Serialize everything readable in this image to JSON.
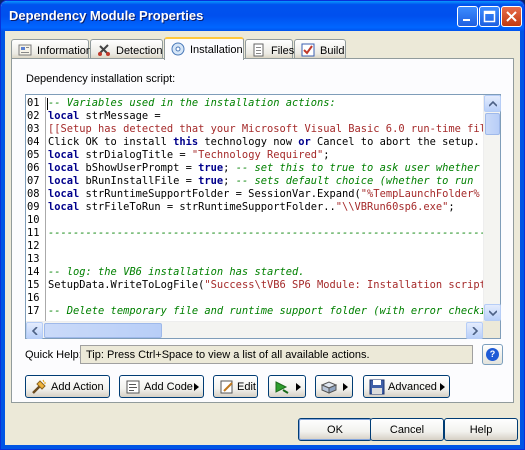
{
  "window": {
    "title": "Dependency Module Properties"
  },
  "tabs": [
    {
      "label": "Information",
      "icon": "information-icon"
    },
    {
      "label": "Detection",
      "icon": "detection-icon"
    },
    {
      "label": "Installation",
      "icon": "installation-icon",
      "active": true
    },
    {
      "label": "Files",
      "icon": "files-icon"
    },
    {
      "label": "Build",
      "icon": "build-icon"
    }
  ],
  "panel": {
    "script_label": "Dependency installation script:"
  },
  "editor": {
    "lines": [
      {
        "num": "01",
        "segments": [
          {
            "t": "-- Variables used in the installation actions:",
            "c": "comment"
          }
        ]
      },
      {
        "num": "02",
        "segments": [
          {
            "t": "local",
            "c": "kw"
          },
          {
            "t": " strMessage =",
            "c": "text"
          }
        ]
      },
      {
        "num": "03",
        "segments": [
          {
            "t": "[[Setup has detected that your Microsoft Visual Basic 6.0 run-time files",
            "c": "str"
          }
        ]
      },
      {
        "num": "04",
        "segments": [
          {
            "t": "Click OK to install ",
            "c": "text"
          },
          {
            "t": "this",
            "c": "kw"
          },
          {
            "t": " technology now ",
            "c": "text"
          },
          {
            "t": "or",
            "c": "kw"
          },
          {
            "t": " Cancel to abort the setup.",
            "c": "text"
          }
        ]
      },
      {
        "num": "05",
        "segments": [
          {
            "t": "local",
            "c": "kw"
          },
          {
            "t": " strDialogTitle = ",
            "c": "text"
          },
          {
            "t": "\"Technology Required\"",
            "c": "str"
          },
          {
            "t": ";",
            "c": "text"
          }
        ]
      },
      {
        "num": "06",
        "segments": [
          {
            "t": "local",
            "c": "kw"
          },
          {
            "t": " bShowUserPrompt = ",
            "c": "text"
          },
          {
            "t": "true",
            "c": "kw"
          },
          {
            "t": "; ",
            "c": "text"
          },
          {
            "t": "-- set this to true to ask user whether",
            "c": "comment"
          }
        ]
      },
      {
        "num": "07",
        "segments": [
          {
            "t": "local",
            "c": "kw"
          },
          {
            "t": " bRunInstallFile = ",
            "c": "text"
          },
          {
            "t": "true",
            "c": "kw"
          },
          {
            "t": "; ",
            "c": "text"
          },
          {
            "t": "-- sets default choice (whether to run",
            "c": "comment"
          }
        ]
      },
      {
        "num": "08",
        "segments": [
          {
            "t": "local",
            "c": "kw"
          },
          {
            "t": " strRuntimeSupportFolder = SessionVar.Expand(",
            "c": "text"
          },
          {
            "t": "\"%TempLaunchFolder%",
            "c": "str"
          }
        ]
      },
      {
        "num": "09",
        "segments": [
          {
            "t": "local",
            "c": "kw"
          },
          {
            "t": " strFileToRun = strRuntimeSupportFolder..",
            "c": "text"
          },
          {
            "t": "\"\\\\VBRun60sp6.exe\"",
            "c": "str"
          },
          {
            "t": ";",
            "c": "text"
          }
        ]
      },
      {
        "num": "10",
        "segments": [
          {
            "t": "",
            "c": "text"
          }
        ]
      },
      {
        "num": "11",
        "segments": [
          {
            "t": "--------------------------------------------------------------------------------------",
            "c": "comment"
          }
        ]
      },
      {
        "num": "12",
        "segments": [
          {
            "t": "",
            "c": "text"
          }
        ]
      },
      {
        "num": "13",
        "segments": [
          {
            "t": "",
            "c": "text"
          }
        ]
      },
      {
        "num": "14",
        "segments": [
          {
            "t": "-- log: the VB6 installation has started.",
            "c": "comment"
          }
        ]
      },
      {
        "num": "15",
        "segments": [
          {
            "t": "SetupData.WriteToLogFile(",
            "c": "text"
          },
          {
            "t": "\"Success\\tVB6 SP6 Module: Installation script",
            "c": "str"
          }
        ]
      },
      {
        "num": "16",
        "segments": [
          {
            "t": "",
            "c": "text"
          }
        ]
      },
      {
        "num": "17",
        "segments": [
          {
            "t": "-- Delete temporary file and runtime support folder (with error checking)",
            "c": "comment"
          }
        ]
      }
    ]
  },
  "quick_help": {
    "label": "Quick Help:",
    "text": "Tip: Press Ctrl+Space to view a list of all available actions."
  },
  "buttons": {
    "add_action": "Add Action",
    "add_code": "Add Code",
    "edit": "Edit",
    "advanced": "Advanced",
    "ok": "OK",
    "cancel": "Cancel",
    "help": "Help"
  },
  "colors": {
    "titlebar": "#0053ee",
    "comment": "#008000",
    "keyword": "#00008b",
    "string": "#a52a2a"
  }
}
